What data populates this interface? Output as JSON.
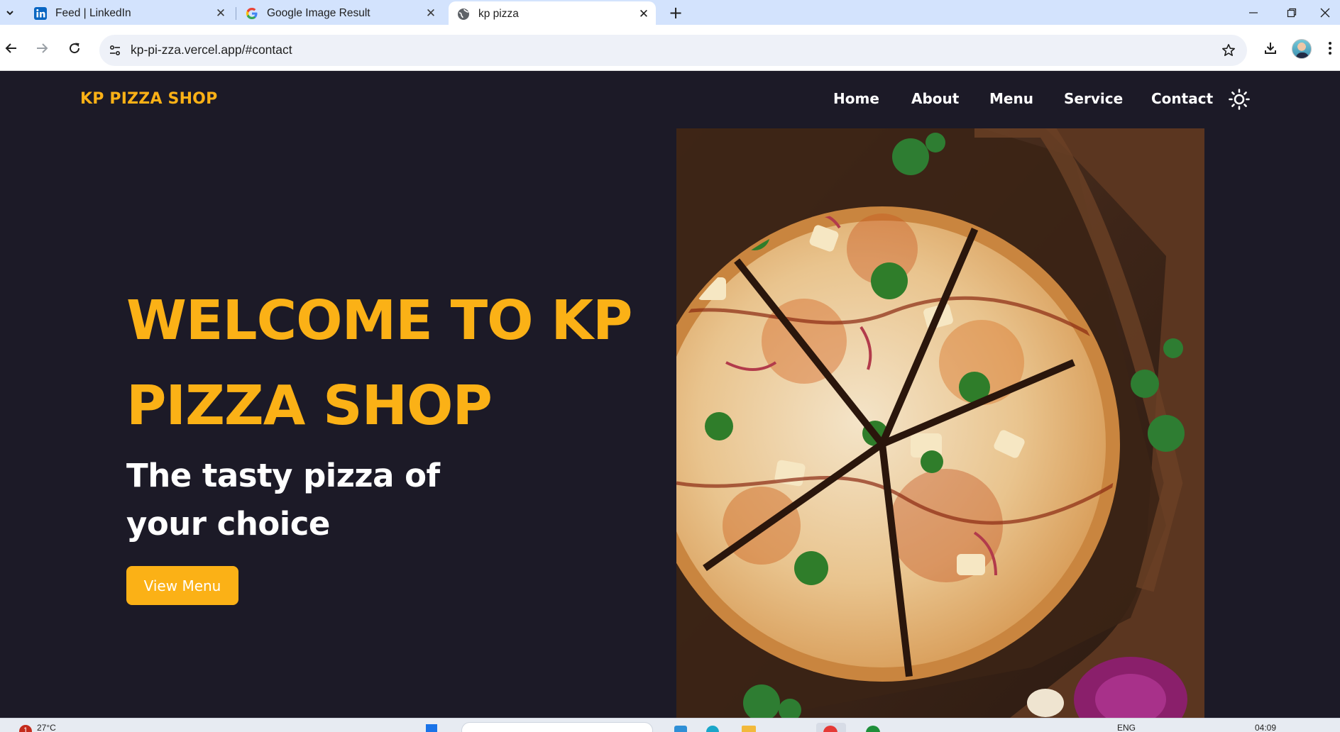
{
  "browser": {
    "tabs": [
      {
        "title": "Feed | LinkedIn",
        "icon": "linkedin-icon",
        "active": false
      },
      {
        "title": "Google Image Result",
        "icon": "google-icon",
        "active": false
      },
      {
        "title": "kp pizza",
        "icon": "globe-icon",
        "active": true
      }
    ],
    "address_bar": {
      "url": "kp-pi-zza.vercel.app/#contact"
    }
  },
  "site": {
    "brand": "KP PIZZA SHOP",
    "nav": [
      {
        "label": "Home"
      },
      {
        "label": "About"
      },
      {
        "label": "Menu"
      },
      {
        "label": "Service"
      },
      {
        "label": "Contact"
      }
    ],
    "theme_toggle_icon": "sun-icon",
    "hero": {
      "title": "WELCOME TO KP PIZZA SHOP",
      "subtitle": "The tasty pizza of your choice",
      "cta": "View Menu",
      "image_icon": "pizza-photo"
    },
    "colors": {
      "background": "#1c1a27",
      "accent": "#fbb116",
      "text": "#ffffff"
    }
  },
  "taskbar": {
    "notification_count": "1",
    "weather": "27°C",
    "language": "ENG",
    "time": "04:09"
  }
}
